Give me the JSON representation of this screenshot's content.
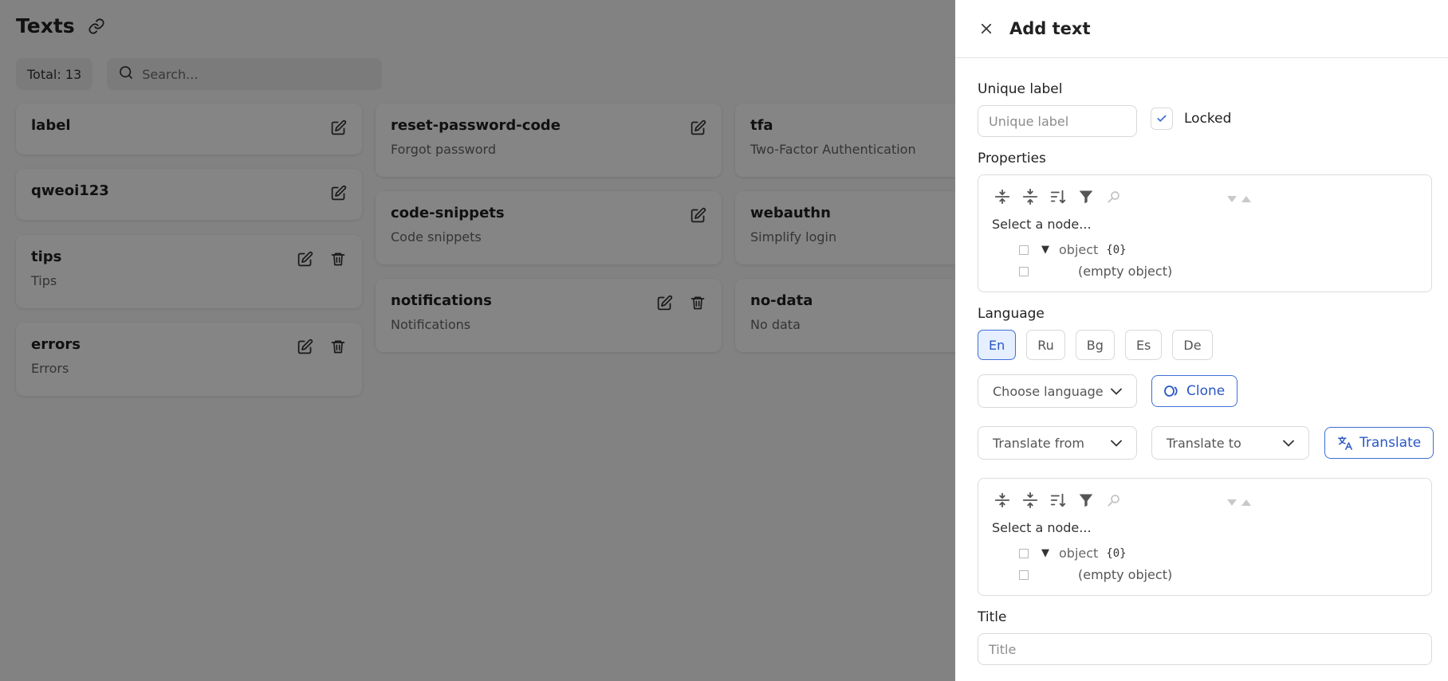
{
  "page": {
    "title": "Texts",
    "total": "Total: 13",
    "search_placeholder": "Search..."
  },
  "cards": [
    {
      "title": "label",
      "subtitle": ""
    },
    {
      "title": "qweoi123",
      "subtitle": ""
    },
    {
      "title": "tips",
      "subtitle": "Tips"
    },
    {
      "title": "errors",
      "subtitle": "Errors"
    },
    {
      "title": "reset-password-code",
      "subtitle": "Forgot password"
    },
    {
      "title": "code-snippets",
      "subtitle": "Code snippets"
    },
    {
      "title": "notifications",
      "subtitle": "Notifications"
    },
    {
      "title": "tfa",
      "subtitle": "Two-Factor Authentication"
    },
    {
      "title": "webauthn",
      "subtitle": "Simplify login"
    },
    {
      "title": "no-data",
      "subtitle": "No data"
    }
  ],
  "drawer": {
    "title": "Add text",
    "unique_label": "Unique label",
    "unique_label_placeholder": "Unique label",
    "locked_label": "Locked",
    "properties_label": "Properties",
    "language_label": "Language",
    "languages": [
      "En",
      "Ru",
      "Bg",
      "Es",
      "De"
    ],
    "active_language": "En",
    "choose_language": "Choose language",
    "clone_label": "Clone",
    "translate_from": "Translate from",
    "translate_to": "Translate to",
    "translate_label": "Translate",
    "title_label": "Title",
    "title_placeholder": "Title"
  },
  "json_editor": {
    "select_node": "Select a node...",
    "root_key": "object",
    "root_count": "{0}",
    "empty_text": "(empty object)"
  },
  "colors": {
    "accent": "#3e6fd8",
    "overlay": "#000000"
  }
}
